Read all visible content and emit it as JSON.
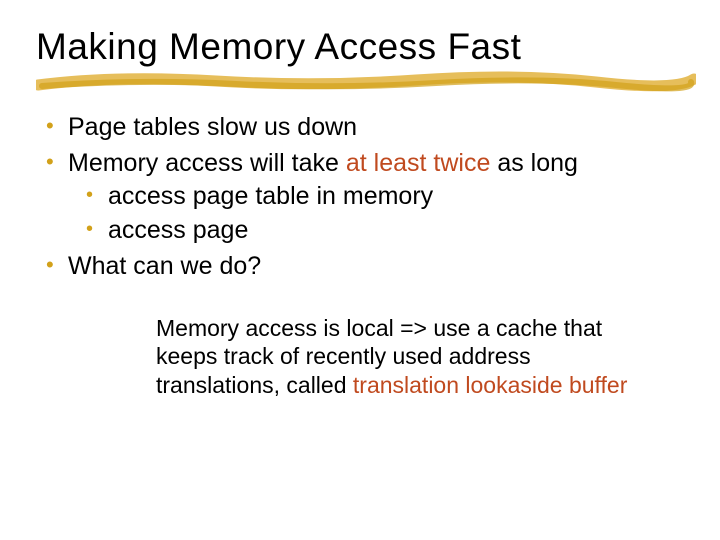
{
  "title": "Making Memory Access Fast",
  "bullets": {
    "b1": "Page tables slow us down",
    "b2_pre": "Memory access will take ",
    "b2_accent": "at least twice",
    "b2_post": " as long",
    "b2_s1": "access page table in memory",
    "b2_s2": "access page",
    "b3": "What can we do?"
  },
  "note": {
    "pre": "Memory access is local => use a cache that keeps track of recently used address translations, called ",
    "accent": "translation lookaside buffer"
  }
}
